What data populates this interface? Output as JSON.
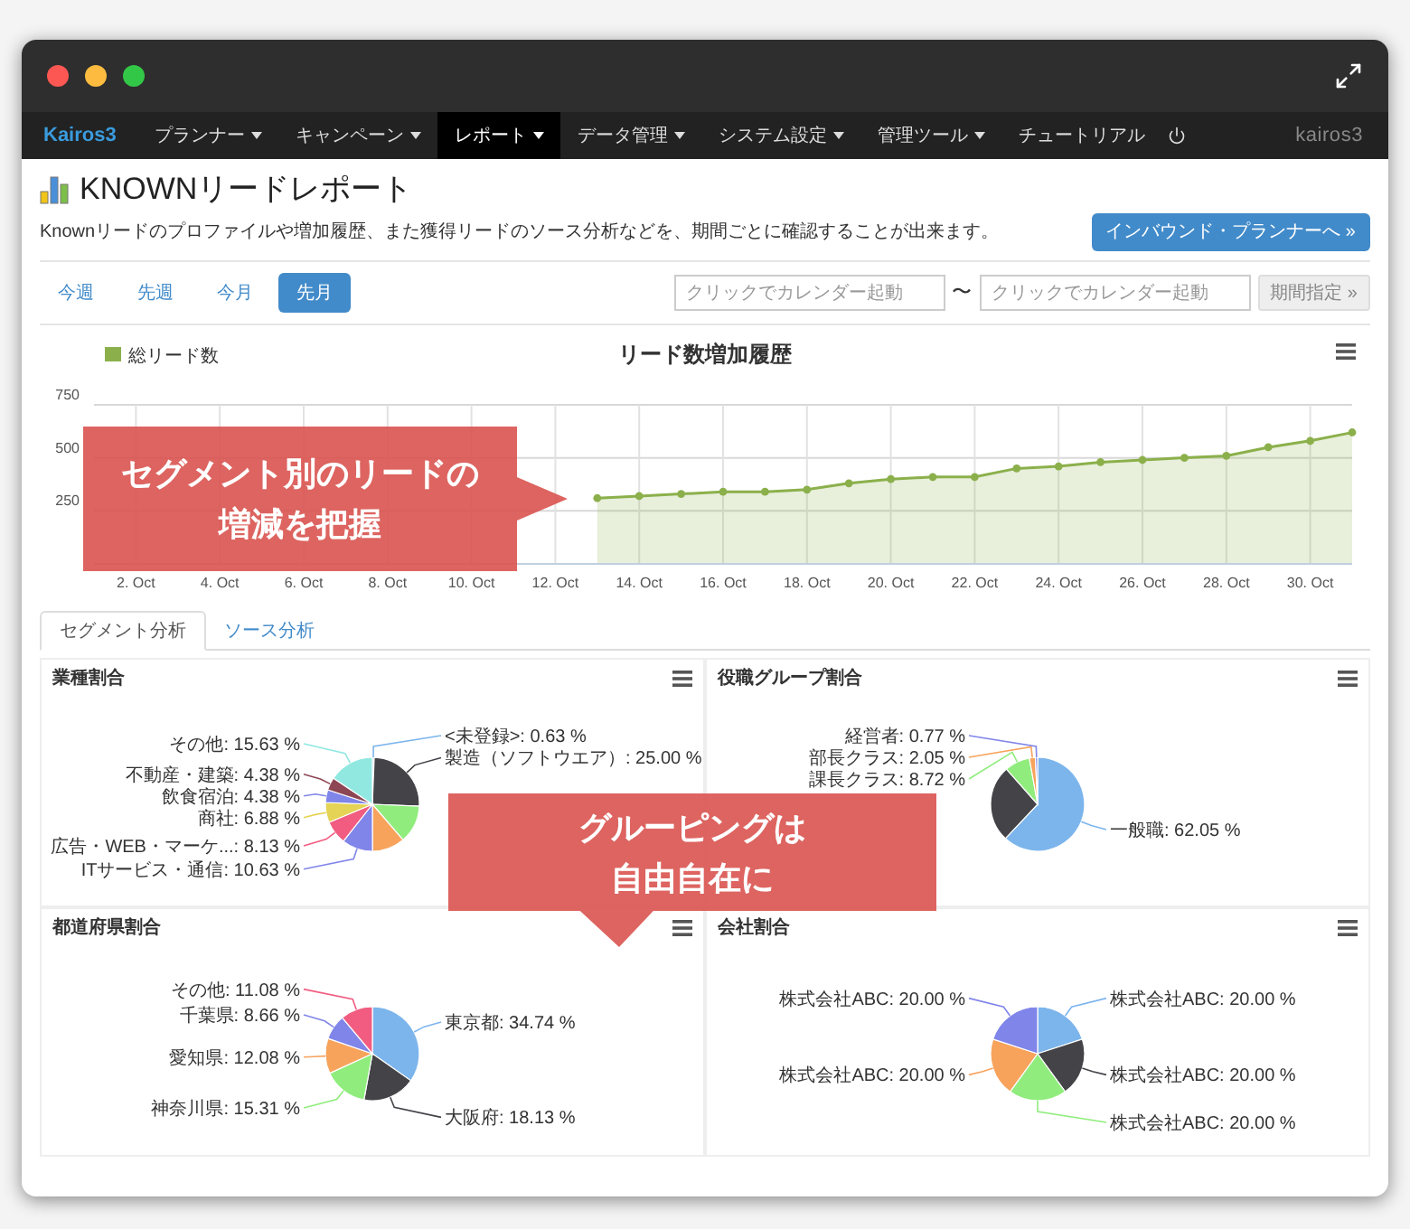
{
  "navbar": {
    "brand": "Kairos3",
    "items": [
      {
        "label": "プランナー",
        "dropdown": true,
        "selected": false
      },
      {
        "label": "キャンペーン",
        "dropdown": true,
        "selected": false
      },
      {
        "label": "レポート",
        "dropdown": true,
        "selected": true
      },
      {
        "label": "データ管理",
        "dropdown": true,
        "selected": false
      },
      {
        "label": "システム設定",
        "dropdown": true,
        "selected": false
      },
      {
        "label": "管理ツール",
        "dropdown": true,
        "selected": false
      },
      {
        "label": "チュートリアル",
        "dropdown": false,
        "selected": false
      }
    ],
    "user": "kairos3"
  },
  "header": {
    "title": "KNOWNリードレポート",
    "description": "Knownリードのプロファイルや増加履歴、また獲得リードのソース分析などを、期間ごとに確認することが出来ます。",
    "action": "インバウンド・プランナーへ »"
  },
  "periods": [
    {
      "label": "今週",
      "selected": false
    },
    {
      "label": "先週",
      "selected": false
    },
    {
      "label": "今月",
      "selected": false
    },
    {
      "label": "先月",
      "selected": true
    }
  ],
  "date_range": {
    "from_placeholder": "クリックでカレンダー起動",
    "separator": "〜",
    "to_placeholder": "クリックでカレンダー起動",
    "button": "期間指定 »"
  },
  "lead_chart": {
    "chart_data": {
      "type": "area",
      "title": "リード数増加履歴",
      "categories": [
        null,
        "2. Oct",
        null,
        "4. Oct",
        null,
        "6. Oct",
        null,
        "8. Oct",
        null,
        "10. Oct",
        null,
        "12. Oct",
        null,
        "14. Oct",
        null,
        "16. Oct",
        null,
        "18. Oct",
        null,
        "20. Oct",
        null,
        "22. Oct",
        null,
        "24. Oct",
        null,
        "26. Oct",
        null,
        "28. Oct",
        null,
        "30. Oct",
        null
      ],
      "series": [
        {
          "name": "総リード数",
          "color": "#8bb04b",
          "values": [
            null,
            null,
            null,
            null,
            null,
            null,
            null,
            null,
            null,
            null,
            null,
            null,
            310,
            320,
            330,
            340,
            340,
            350,
            380,
            400,
            410,
            410,
            450,
            460,
            480,
            490,
            500,
            510,
            550,
            580,
            620
          ]
        }
      ],
      "ylim": [
        0,
        750
      ],
      "yticks": [
        250,
        500,
        750
      ],
      "grid": true
    }
  },
  "tabs": [
    {
      "label": "セグメント分析",
      "selected": true
    },
    {
      "label": "ソース分析",
      "selected": false
    }
  ],
  "panels": [
    {
      "chart_data": {
        "type": "pie",
        "title": "業種割合",
        "values": [
          0.63,
          25.0,
          13.09,
          11.25,
          10.63,
          8.13,
          6.88,
          4.38,
          4.38,
          15.63
        ],
        "value_labels": [
          "<未登録>: 0.63 %",
          "製造（ソフトウエア）: 25.00 %",
          null,
          null,
          "ITサービス・通信: 10.63 %",
          "広告・WEB・マーケ...: 8.13 %",
          "商社: 6.88 %",
          "飲食宿泊: 4.38 %",
          "不動産・建築: 4.38 %",
          "その他: 15.63 %"
        ]
      }
    },
    {
      "chart_data": {
        "type": "pie",
        "title": "役職グループ割合",
        "values": [
          62.05,
          26.41,
          8.72,
          2.05,
          0.77
        ],
        "value_labels": [
          "一般職: 62.05 %",
          null,
          "課長クラス: 8.72 %",
          "部長クラス: 2.05 %",
          "経営者: 0.77 %"
        ]
      }
    },
    {
      "chart_data": {
        "type": "pie",
        "title": "都道府県割合",
        "values": [
          34.74,
          18.13,
          15.31,
          12.08,
          8.66,
          11.08
        ],
        "value_labels": [
          "東京都: 34.74 %",
          "大阪府: 18.13 %",
          "神奈川県: 15.31 %",
          "愛知県: 12.08 %",
          "千葉県: 8.66 %",
          "その他: 11.08 %"
        ]
      }
    },
    {
      "chart_data": {
        "type": "pie",
        "title": "会社割合",
        "values": [
          20,
          20,
          20,
          20,
          20
        ],
        "value_labels": [
          "株式会社ABC: 20.00 %",
          "株式会社ABC: 20.00 %",
          "株式会社ABC: 20.00 %",
          "株式会社ABC: 20.00 %",
          "株式会社ABC: 20.00 %"
        ]
      }
    }
  ],
  "callouts": [
    {
      "kind": "right",
      "lines": [
        "セグメント別のリードの",
        "増減を把握"
      ]
    },
    {
      "kind": "down",
      "lines": [
        "グルーピングは",
        "自由自在に"
      ]
    }
  ]
}
